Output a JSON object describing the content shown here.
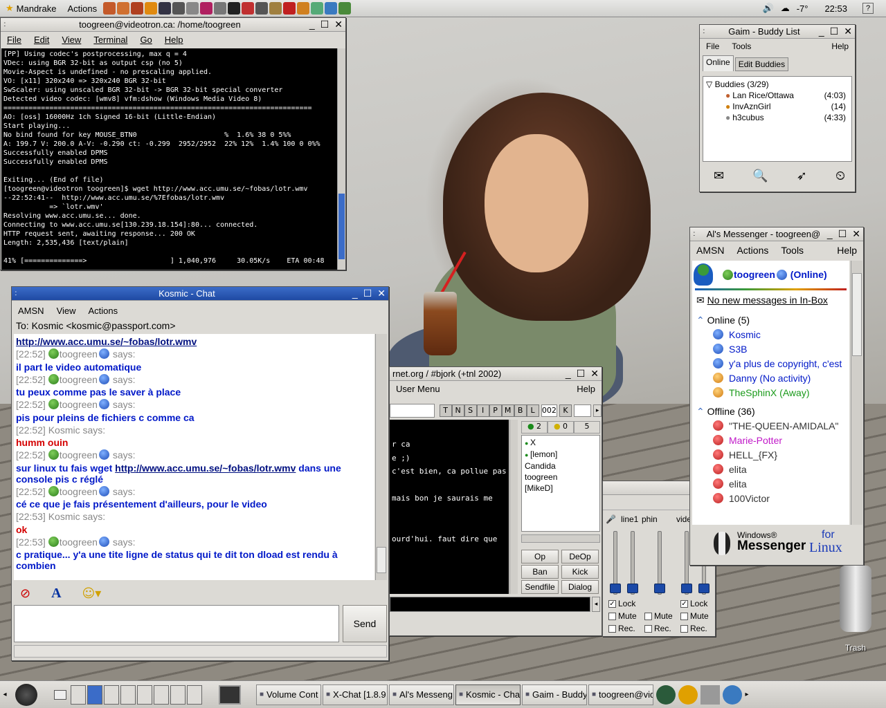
{
  "topbar": {
    "app_menu": "Mandrake",
    "actions": "Actions",
    "temp": "-7°",
    "clock": "22:53"
  },
  "terminal": {
    "title": "toogreen@videotron.ca: /home/toogreen",
    "menu": [
      "File",
      "Edit",
      "View",
      "Terminal",
      "Go",
      "Help"
    ],
    "lines": [
      "[PP] Using codec's postprocessing, max q = 4",
      "VDec: using BGR 32-bit as output csp (no 5)",
      "Movie-Aspect is undefined - no prescaling applied.",
      "VO: [x11] 320x240 => 320x240 BGR 32-bit",
      "SwScaler: using unscaled BGR 32-bit -> BGR 32-bit special converter",
      "Detected video codec: [wmv8] vfm:dshow (Windows Media Video 8)",
      "==========================================================================",
      "AO: [oss] 16000Hz 1ch Signed 16-bit (Little-Endian)",
      "Start playing...",
      "No bind found for key MOUSE_BTN0                     %  1.6% 38 0 5%%",
      "A: 199.7 V: 200.0 A-V: -0.290 ct: -0.299  2952/2952  22% 12%  1.4% 100 0 0%%",
      "Successfully enabled DPMS",
      "Successfully enabled DPMS",
      "",
      "Exiting... (End of file)",
      "[toogreen@videotron toogreen]$ wget http://www.acc.umu.se/~fobas/lotr.wmv",
      "--22:52:41--  http://www.acc.umu.se/%7Efobas/lotr.wmv",
      "           => `lotr.wmv'",
      "Resolving www.acc.umu.se... done.",
      "Connecting to www.acc.umu.se[130.239.18.154]:80... connected.",
      "HTTP request sent, awaiting response... 200 OK",
      "Length: 2,535,436 [text/plain]",
      "",
      "41% [==============>                    ] 1,040,976     30.05K/s    ETA 00:48"
    ]
  },
  "chat": {
    "title": "Kosmic - Chat",
    "menu": [
      "AMSN",
      "View",
      "Actions"
    ],
    "to": "To: Kosmic <kosmic@passport.com>",
    "link_first": "http://www.acc.umu.se/~fobas/lotr.wmv",
    "send": "Send",
    "says": "says:",
    "me": "toogreen",
    "entries": [
      {
        "t": "[22:52]",
        "who": "toogreen",
        "says": "says:",
        "msg": "il part le video automatique",
        "red": false
      },
      {
        "t": "[22:52]",
        "who": "toogreen",
        "says": "says:",
        "msg": "tu peux comme pas le saver à place",
        "red": false
      },
      {
        "t": "[22:52]",
        "who": "toogreen",
        "says": "says:",
        "msg": "pis pour pleins de fichiers c comme ca",
        "red": false
      },
      {
        "t": "[22:52]",
        "who": "Kosmic",
        "says": "says:",
        "msg": "humm ouin",
        "red": true
      },
      {
        "t": "[22:52]",
        "who": "toogreen",
        "says": "says:",
        "msg_a": "sur linux tu fais wget ",
        "link": "http://www.acc.umu.se/~fobas/lotr.wmv",
        "msg_b": "   dans une console pis c réglé",
        "red": false
      },
      {
        "t": "[22:52]",
        "who": "toogreen",
        "says": "says:",
        "msg": "cé ce que je fais présentement d'ailleurs, pour le video",
        "red": false
      },
      {
        "t": "[22:53]",
        "who": "Kosmic",
        "says": "says:",
        "msg": "ok",
        "red": true
      },
      {
        "t": "[22:53]",
        "who": "toogreen",
        "says": "says:",
        "msg": "c pratique... y'a une tite ligne de status qui te dit ton dload est rendu à combien",
        "red": false
      }
    ]
  },
  "gaim": {
    "title": "Gaim - Buddy List",
    "menu_file": "File",
    "menu_tools": "Tools",
    "menu_help": "Help",
    "tab_online": "Online",
    "tab_edit": "Edit Buddies",
    "group": "Buddies (3/29)",
    "buddies": [
      {
        "name": "Lan Rice/Ottawa",
        "time": "(4:03)"
      },
      {
        "name": "InvAznGirl",
        "time": "(14)"
      },
      {
        "name": "h3cubus",
        "time": "(4:33)"
      }
    ]
  },
  "amsn": {
    "title": "Al's Messenger - toogreen@",
    "menu": [
      "AMSN",
      "Actions",
      "Tools"
    ],
    "help": "Help",
    "user": "toogreen",
    "status": "(Online)",
    "inbox": "No new messages in In-Box",
    "online_hdr": "Online (5)",
    "online": [
      {
        "name": "Kosmic",
        "icon": "b"
      },
      {
        "name": "S3B",
        "icon": "b"
      },
      {
        "name": "y'a plus de copyright, c'est",
        "icon": "b"
      },
      {
        "name": "Danny (No activity)",
        "icon": "o"
      },
      {
        "name": "TheSphinX",
        "extra": "(Away)",
        "icon": "o",
        "green": true
      }
    ],
    "offline_hdr": "Offline (36)",
    "offline": [
      {
        "name": "\"THE-QUEEN-AMIDALA\"",
        "color": "#333"
      },
      {
        "name": "Marie-Potter",
        "color": "#c018c8"
      },
      {
        "name": "HELL_{FX}",
        "color": "#333"
      },
      {
        "name": "elita",
        "color": "#333"
      },
      {
        "name": "elita",
        "color": "#333"
      },
      {
        "name": "100Victor",
        "color": "#333"
      }
    ],
    "logo_windows": "Windows®",
    "logo_messenger": "Messenger",
    "logo_for": "for",
    "logo_linux": "Linux"
  },
  "xchat": {
    "title": "rnet.org / #bjork (+tnl 2002)",
    "menu_user": "User Menu",
    "help": "Help",
    "modes": [
      "T",
      "N",
      "S",
      "I",
      "P",
      "M",
      "B",
      "L"
    ],
    "limit": "002",
    "key": "K",
    "ops": "2",
    "voices": "0",
    "total": "5",
    "users": [
      "X",
      "[lemon]",
      "Candida",
      "toogreen",
      "[MikeD]"
    ],
    "lines": [
      "r ca",
      "e ;)",
      "c'est bien, ca pollue pas",
      "",
      "mais bon je saurais me",
      "",
      "",
      "ourd'hui. faut dire que"
    ],
    "btns": [
      "Op",
      "DeOp",
      "Ban",
      "Kick",
      "Sendfile",
      "Dialog"
    ]
  },
  "volume": {
    "channels": [
      "line1",
      "phin",
      "video"
    ],
    "lock": "Lock",
    "mute": "Mute",
    "rec": "Rec."
  },
  "desktop": {
    "trash": "Trash"
  },
  "taskbar": {
    "tasks": [
      "Volume Cont",
      "X-Chat [1.8.9",
      "Al's Messeng",
      "Kosmic - Cha",
      "Gaim - Buddy",
      "toogreen@vid"
    ]
  }
}
